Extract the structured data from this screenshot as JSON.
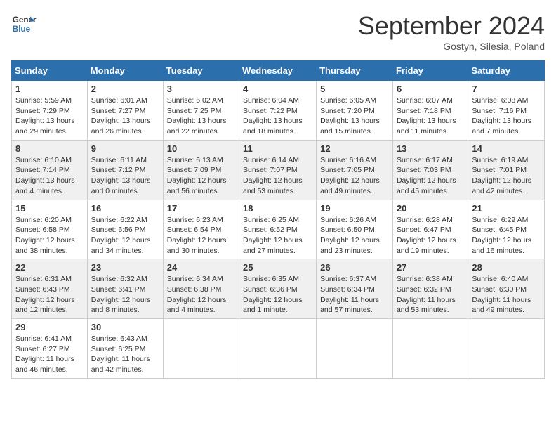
{
  "header": {
    "logo_line1": "General",
    "logo_line2": "Blue",
    "month_title": "September 2024",
    "location": "Gostyn, Silesia, Poland"
  },
  "columns": [
    "Sunday",
    "Monday",
    "Tuesday",
    "Wednesday",
    "Thursday",
    "Friday",
    "Saturday"
  ],
  "weeks": [
    [
      {
        "day": "1",
        "sunrise": "Sunrise: 5:59 AM",
        "sunset": "Sunset: 7:29 PM",
        "daylight": "Daylight: 13 hours and 29 minutes."
      },
      {
        "day": "2",
        "sunrise": "Sunrise: 6:01 AM",
        "sunset": "Sunset: 7:27 PM",
        "daylight": "Daylight: 13 hours and 26 minutes."
      },
      {
        "day": "3",
        "sunrise": "Sunrise: 6:02 AM",
        "sunset": "Sunset: 7:25 PM",
        "daylight": "Daylight: 13 hours and 22 minutes."
      },
      {
        "day": "4",
        "sunrise": "Sunrise: 6:04 AM",
        "sunset": "Sunset: 7:22 PM",
        "daylight": "Daylight: 13 hours and 18 minutes."
      },
      {
        "day": "5",
        "sunrise": "Sunrise: 6:05 AM",
        "sunset": "Sunset: 7:20 PM",
        "daylight": "Daylight: 13 hours and 15 minutes."
      },
      {
        "day": "6",
        "sunrise": "Sunrise: 6:07 AM",
        "sunset": "Sunset: 7:18 PM",
        "daylight": "Daylight: 13 hours and 11 minutes."
      },
      {
        "day": "7",
        "sunrise": "Sunrise: 6:08 AM",
        "sunset": "Sunset: 7:16 PM",
        "daylight": "Daylight: 13 hours and 7 minutes."
      }
    ],
    [
      {
        "day": "8",
        "sunrise": "Sunrise: 6:10 AM",
        "sunset": "Sunset: 7:14 PM",
        "daylight": "Daylight: 13 hours and 4 minutes."
      },
      {
        "day": "9",
        "sunrise": "Sunrise: 6:11 AM",
        "sunset": "Sunset: 7:12 PM",
        "daylight": "Daylight: 13 hours and 0 minutes."
      },
      {
        "day": "10",
        "sunrise": "Sunrise: 6:13 AM",
        "sunset": "Sunset: 7:09 PM",
        "daylight": "Daylight: 12 hours and 56 minutes."
      },
      {
        "day": "11",
        "sunrise": "Sunrise: 6:14 AM",
        "sunset": "Sunset: 7:07 PM",
        "daylight": "Daylight: 12 hours and 53 minutes."
      },
      {
        "day": "12",
        "sunrise": "Sunrise: 6:16 AM",
        "sunset": "Sunset: 7:05 PM",
        "daylight": "Daylight: 12 hours and 49 minutes."
      },
      {
        "day": "13",
        "sunrise": "Sunrise: 6:17 AM",
        "sunset": "Sunset: 7:03 PM",
        "daylight": "Daylight: 12 hours and 45 minutes."
      },
      {
        "day": "14",
        "sunrise": "Sunrise: 6:19 AM",
        "sunset": "Sunset: 7:01 PM",
        "daylight": "Daylight: 12 hours and 42 minutes."
      }
    ],
    [
      {
        "day": "15",
        "sunrise": "Sunrise: 6:20 AM",
        "sunset": "Sunset: 6:58 PM",
        "daylight": "Daylight: 12 hours and 38 minutes."
      },
      {
        "day": "16",
        "sunrise": "Sunrise: 6:22 AM",
        "sunset": "Sunset: 6:56 PM",
        "daylight": "Daylight: 12 hours and 34 minutes."
      },
      {
        "day": "17",
        "sunrise": "Sunrise: 6:23 AM",
        "sunset": "Sunset: 6:54 PM",
        "daylight": "Daylight: 12 hours and 30 minutes."
      },
      {
        "day": "18",
        "sunrise": "Sunrise: 6:25 AM",
        "sunset": "Sunset: 6:52 PM",
        "daylight": "Daylight: 12 hours and 27 minutes."
      },
      {
        "day": "19",
        "sunrise": "Sunrise: 6:26 AM",
        "sunset": "Sunset: 6:50 PM",
        "daylight": "Daylight: 12 hours and 23 minutes."
      },
      {
        "day": "20",
        "sunrise": "Sunrise: 6:28 AM",
        "sunset": "Sunset: 6:47 PM",
        "daylight": "Daylight: 12 hours and 19 minutes."
      },
      {
        "day": "21",
        "sunrise": "Sunrise: 6:29 AM",
        "sunset": "Sunset: 6:45 PM",
        "daylight": "Daylight: 12 hours and 16 minutes."
      }
    ],
    [
      {
        "day": "22",
        "sunrise": "Sunrise: 6:31 AM",
        "sunset": "Sunset: 6:43 PM",
        "daylight": "Daylight: 12 hours and 12 minutes."
      },
      {
        "day": "23",
        "sunrise": "Sunrise: 6:32 AM",
        "sunset": "Sunset: 6:41 PM",
        "daylight": "Daylight: 12 hours and 8 minutes."
      },
      {
        "day": "24",
        "sunrise": "Sunrise: 6:34 AM",
        "sunset": "Sunset: 6:38 PM",
        "daylight": "Daylight: 12 hours and 4 minutes."
      },
      {
        "day": "25",
        "sunrise": "Sunrise: 6:35 AM",
        "sunset": "Sunset: 6:36 PM",
        "daylight": "Daylight: 12 hours and 1 minute."
      },
      {
        "day": "26",
        "sunrise": "Sunrise: 6:37 AM",
        "sunset": "Sunset: 6:34 PM",
        "daylight": "Daylight: 11 hours and 57 minutes."
      },
      {
        "day": "27",
        "sunrise": "Sunrise: 6:38 AM",
        "sunset": "Sunset: 6:32 PM",
        "daylight": "Daylight: 11 hours and 53 minutes."
      },
      {
        "day": "28",
        "sunrise": "Sunrise: 6:40 AM",
        "sunset": "Sunset: 6:30 PM",
        "daylight": "Daylight: 11 hours and 49 minutes."
      }
    ],
    [
      {
        "day": "29",
        "sunrise": "Sunrise: 6:41 AM",
        "sunset": "Sunset: 6:27 PM",
        "daylight": "Daylight: 11 hours and 46 minutes."
      },
      {
        "day": "30",
        "sunrise": "Sunrise: 6:43 AM",
        "sunset": "Sunset: 6:25 PM",
        "daylight": "Daylight: 11 hours and 42 minutes."
      },
      null,
      null,
      null,
      null,
      null
    ]
  ]
}
